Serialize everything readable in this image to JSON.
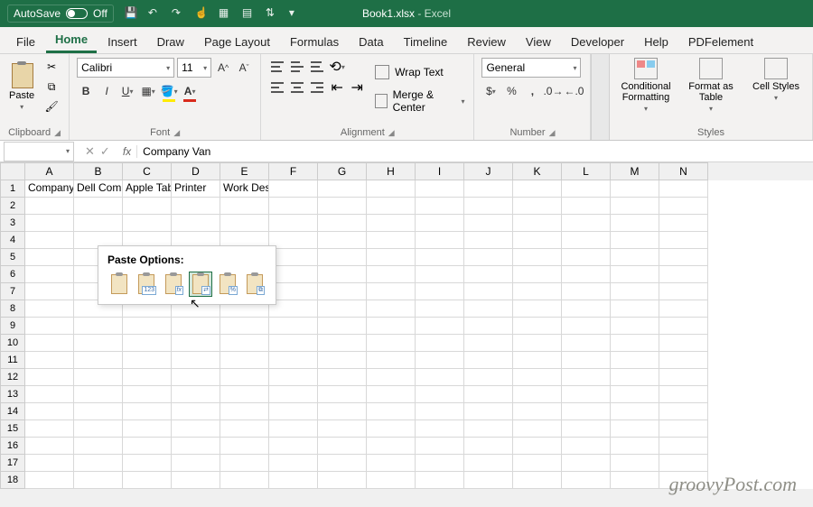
{
  "titlebar": {
    "autosave_label": "AutoSave",
    "autosave_state": "Off",
    "filename": "Book1.xlsx",
    "app": "Excel"
  },
  "tabs": [
    "File",
    "Home",
    "Insert",
    "Draw",
    "Page Layout",
    "Formulas",
    "Data",
    "Timeline",
    "Review",
    "View",
    "Developer",
    "Help",
    "PDFelement"
  ],
  "active_tab": "Home",
  "ribbon": {
    "clipboard": {
      "label": "Clipboard",
      "paste": "Paste"
    },
    "font": {
      "label": "Font",
      "name": "Calibri",
      "size": "11"
    },
    "alignment": {
      "label": "Alignment",
      "wrap": "Wrap Text",
      "merge": "Merge & Center"
    },
    "number": {
      "label": "Number",
      "format": "General"
    },
    "styles": {
      "label": "Styles",
      "cond": "Conditional Formatting",
      "table": "Format as Table",
      "cell": "Cell Styles"
    }
  },
  "formula_bar": {
    "value": "Company Van"
  },
  "columns": [
    "A",
    "B",
    "C",
    "D",
    "E",
    "F",
    "G",
    "H",
    "I",
    "J",
    "K",
    "L",
    "M",
    "N"
  ],
  "rows": 18,
  "cell_data": {
    "1": {
      "A": "Company",
      "B": "Dell Comp",
      "C": "Apple Tab",
      "D": "Printer",
      "E": "Work Desk"
    }
  },
  "paste_popup": {
    "title": "Paste Options:",
    "options": [
      "paste",
      "values",
      "formulas",
      "transpose",
      "formatting",
      "link"
    ]
  },
  "watermark": "groovyPost.com"
}
